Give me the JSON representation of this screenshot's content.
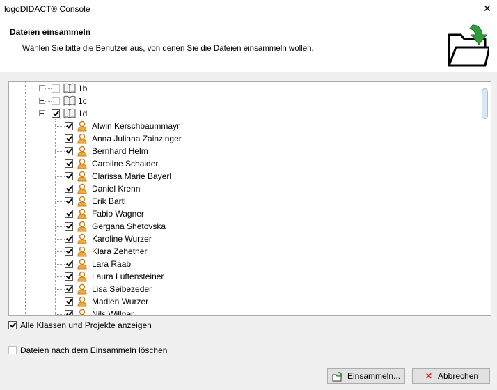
{
  "window": {
    "title": "logoDIDACT® Console",
    "close_icon": "close-icon"
  },
  "header": {
    "title": "Dateien einsammeln",
    "subtitle": "Wählen Sie bitte die Benutzer aus, von denen Sie die Dateien einsammeln wollen.",
    "icon": "folder-collect-icon",
    "accent_color": "#2e9c3a",
    "divider_color": "#4a90d9"
  },
  "tree": {
    "groups": [
      {
        "label": "1b",
        "expanded": false,
        "checked": false
      },
      {
        "label": "1c",
        "expanded": false,
        "checked": false
      },
      {
        "label": "1d",
        "expanded": true,
        "checked": true
      }
    ],
    "users": [
      "Alwin Kerschbaummayr",
      "Anna Juliana Zainzinger",
      "Bernhard Helm",
      "Caroline Schaider",
      "Clarissa Marie Bayerl",
      "Daniel Krenn",
      "Erik Bartl",
      "Fabio Wagner",
      "Gergana Shetovska",
      "Karoline Wurzer",
      "Klara Zehetner",
      "Lara Raab",
      "Laura Luftensteiner",
      "Lisa Seibezeder",
      "Madlen Wurzer",
      "Nils Willner"
    ]
  },
  "options": {
    "show_all_label": "Alle Klassen und Projekte anzeigen",
    "show_all_checked": true,
    "delete_label": "Dateien nach dem Einsammeln löschen",
    "delete_checked": false
  },
  "buttons": {
    "collect_label": "Einsammeln...",
    "cancel_label": "Abbrechen",
    "cancel_icon_color": "#d9262a"
  }
}
